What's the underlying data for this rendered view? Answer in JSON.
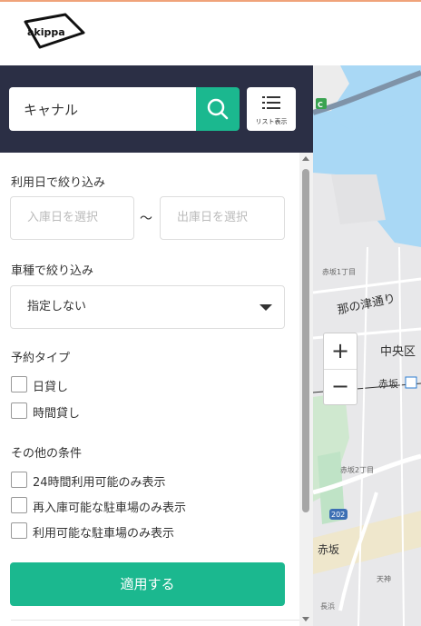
{
  "brand": {
    "logo_text": "akippa"
  },
  "search": {
    "value": "キャナル",
    "list_view_label": "リスト表示"
  },
  "filters": {
    "date": {
      "title": "利用日で絞り込み",
      "checkin_placeholder": "入庫日を選択",
      "separator": "〜",
      "checkout_placeholder": "出庫日を選択"
    },
    "vehicle": {
      "title": "車種で絞り込み",
      "selected": "指定しない"
    },
    "reservation_type": {
      "title": "予約タイプ",
      "options": [
        "日貸し",
        "時間貸し"
      ]
    },
    "other": {
      "title": "その他の条件",
      "options": [
        "24時間利用可能のみ表示",
        "再入庫可能な駐車場のみ表示",
        "利用可能な駐車場のみ表示"
      ]
    },
    "apply_label": "適用する"
  },
  "map": {
    "zoom_in": "+",
    "zoom_out": "−",
    "labels": {
      "district": "中央区",
      "street": "那の津通り",
      "station": "赤坂",
      "area": "赤坂",
      "route_badge": "202",
      "expressway_badge": "C"
    },
    "small_labels": {
      "a": "赤坂1丁目",
      "b": "赤坂2丁目",
      "c": "天神",
      "d": "長浜"
    }
  },
  "colors": {
    "accent": "#1bb88f",
    "header_dark": "#2b2f45",
    "top_border": "#f0a37a"
  }
}
